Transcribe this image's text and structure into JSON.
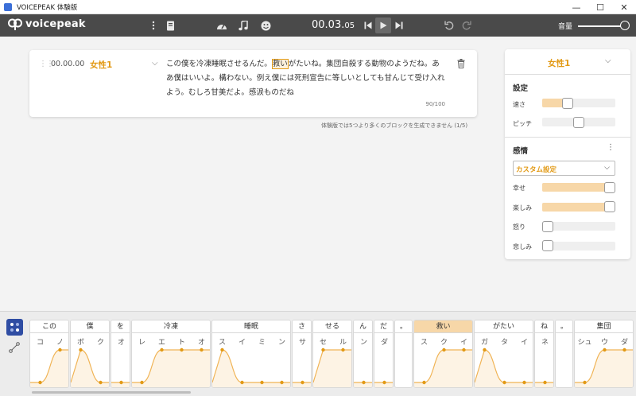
{
  "window": {
    "title": "VOICEPEAK 体験版",
    "controls": [
      "—",
      "☐",
      "✕"
    ]
  },
  "toolbar": {
    "logo_text": "voicepeak",
    "icons": [
      "more-vertical-icon",
      "book-icon",
      "speed-icon",
      "music-note-icon",
      "smiley-icon",
      "skip-back-icon",
      "play-icon",
      "skip-forward-icon",
      "undo-icon",
      "redo-icon"
    ],
    "time_main": "00.03.",
    "time_small": "05",
    "volume_label": "音量",
    "volume_level": 1.0
  },
  "block": {
    "time": "00.00.00",
    "voice": "女性1",
    "text_before": "この僕を冷凍睡眠させるんだ。",
    "text_highlight": "救い",
    "text_after": "がたいね。集団自殺する動物のようだね。ああ僕はいいよ。構わない。例え僕には死刑宣告に等しいとしても甘んじて受け入れよう。むしろ甘美だよ。感涙ものだね",
    "char_count": "90/100",
    "limit_note": "体験版では5つより多くのブロックを生成できません (1/5)"
  },
  "panel": {
    "voice": "女性1",
    "settings_title": "設定",
    "speed_label": "速さ",
    "speed_value": 0.32,
    "pitch_label": "ピッチ",
    "pitch_value": 0.5,
    "emotion_title": "感情",
    "preset": "カスタム設定",
    "emotions": [
      {
        "label": "幸せ",
        "value": 1.0
      },
      {
        "label": "楽しみ",
        "value": 1.0
      },
      {
        "label": "怒り",
        "value": 0.0
      },
      {
        "label": "悲しみ",
        "value": 0.0
      }
    ]
  },
  "editor": {
    "words": [
      {
        "label": "この",
        "moras": [
          "コ",
          "ノ"
        ],
        "selected": false
      },
      {
        "label": "僕",
        "moras": [
          "ボ",
          "ク"
        ],
        "selected": false
      },
      {
        "label": "を",
        "moras": [
          "オ"
        ],
        "selected": false
      },
      {
        "label": "冷凍",
        "moras": [
          "レ",
          "エ",
          "ト",
          "オ"
        ],
        "selected": false
      },
      {
        "label": "睡眠",
        "moras": [
          "ス",
          "イ",
          "ミ",
          "ン"
        ],
        "selected": false
      },
      {
        "label": "さ",
        "moras": [
          "サ"
        ],
        "selected": false
      },
      {
        "label": "せる",
        "moras": [
          "セ",
          "ル"
        ],
        "selected": false
      },
      {
        "label": "ん",
        "moras": [
          "ン"
        ],
        "selected": false
      },
      {
        "label": "だ",
        "moras": [
          "ダ"
        ],
        "selected": false
      },
      {
        "label": "。",
        "moras": [],
        "selected": false
      },
      {
        "label": "救い",
        "moras": [
          "ス",
          "ク",
          "イ"
        ],
        "selected": true
      },
      {
        "label": "がたい",
        "moras": [
          "ガ",
          "タ",
          "イ"
        ],
        "selected": false
      },
      {
        "label": "ね",
        "moras": [
          "ネ"
        ],
        "selected": false
      },
      {
        "label": "。",
        "moras": [],
        "selected": false
      },
      {
        "label": "集団",
        "moras": [
          "シュ",
          "ウ",
          "ダ"
        ],
        "selected": false
      }
    ]
  }
}
